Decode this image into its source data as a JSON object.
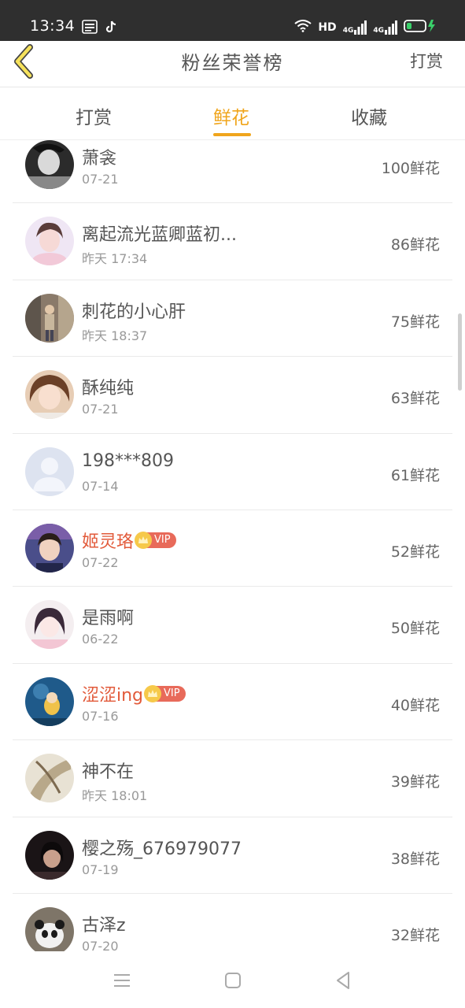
{
  "status_bar": {
    "time": "13:34",
    "hd_label": "HD",
    "net1": "4G",
    "net2": "4G"
  },
  "header": {
    "title": "粉丝荣誉榜",
    "action": "打赏"
  },
  "tabs": [
    {
      "label": "打赏",
      "active": false
    },
    {
      "label": "鲜花",
      "active": true
    },
    {
      "label": "收藏",
      "active": false
    }
  ],
  "accent_color": "#f0a51c",
  "vip_label": "VIP",
  "list": [
    {
      "name": "萧衾",
      "date": "07-21",
      "amount": "100鲜花",
      "vip": false,
      "avatar": "bw"
    },
    {
      "name": "离起流光蓝卿蓝初...",
      "date": "昨天 17:34",
      "amount": "86鲜花",
      "vip": false,
      "avatar": "pink"
    },
    {
      "name": "刺花的小心肝",
      "date": "昨天 18:37",
      "amount": "75鲜花",
      "vip": false,
      "avatar": "street"
    },
    {
      "name": "酥纯纯",
      "date": "07-21",
      "amount": "63鲜花",
      "vip": false,
      "avatar": "girl"
    },
    {
      "name": "198***809",
      "date": "07-14",
      "amount": "61鲜花",
      "vip": false,
      "avatar": "default"
    },
    {
      "name": "姬灵珞",
      "date": "07-22",
      "amount": "52鲜花",
      "vip": true,
      "avatar": "boy"
    },
    {
      "name": "是雨啊",
      "date": "06-22",
      "amount": "50鲜花",
      "vip": false,
      "avatar": "anime"
    },
    {
      "name": "涩涩ing",
      "date": "07-16",
      "amount": "40鲜花",
      "vip": true,
      "avatar": "cartoon"
    },
    {
      "name": "神不在",
      "date": "昨天 18:01",
      "amount": "39鲜花",
      "vip": false,
      "avatar": "art"
    },
    {
      "name": "樱之殇_676979077",
      "date": "07-19",
      "amount": "38鲜花",
      "vip": false,
      "avatar": "dark"
    },
    {
      "name": "古泽z",
      "date": "07-20",
      "amount": "32鲜花",
      "vip": false,
      "avatar": "panda"
    }
  ]
}
